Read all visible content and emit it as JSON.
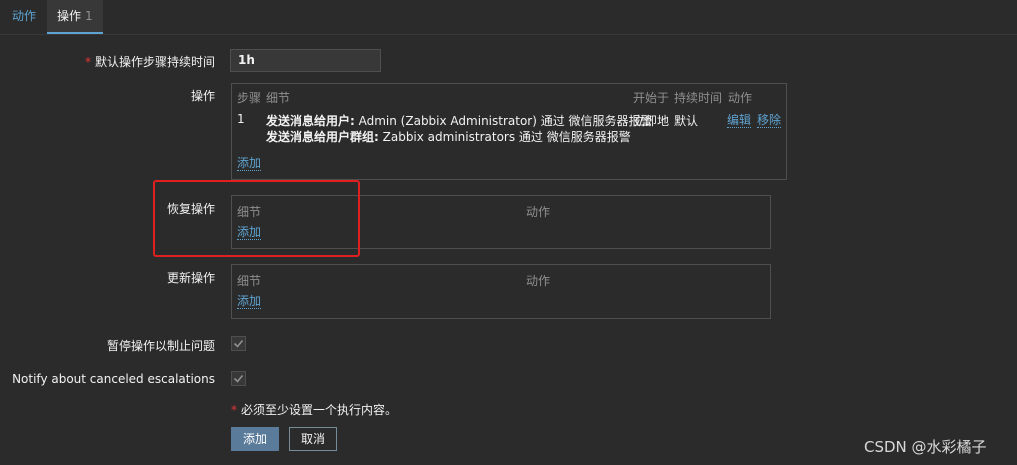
{
  "tabs": [
    {
      "label": "动作",
      "count": ""
    },
    {
      "label": "操作",
      "count": "1"
    }
  ],
  "form": {
    "default_duration": {
      "required": "*",
      "label": "默认操作步骤持续时间",
      "value": "1h"
    },
    "operations": {
      "label": "操作",
      "headers": {
        "step": "步骤",
        "details": "细节",
        "start": "开始于",
        "duration": "持续时间",
        "action": "动作"
      },
      "rows": [
        {
          "step": "1",
          "line1_bold": "发送消息给用户:",
          "line1_rest": " Admin (Zabbix Administrator) 通过 微信服务器报警",
          "line2_bold": "发送消息给用户群组:",
          "line2_rest": " Zabbix administrators 通过 微信服务器报警",
          "start": "立即地",
          "duration": "默认",
          "edit": "编辑",
          "remove": "移除"
        }
      ],
      "add": "添加"
    },
    "recovery": {
      "label": "恢复操作",
      "headers": {
        "details": "细节",
        "action": "动作"
      },
      "add": "添加"
    },
    "update": {
      "label": "更新操作",
      "headers": {
        "details": "细节",
        "action": "动作"
      },
      "add": "添加"
    },
    "pause": {
      "label": "暂停操作以制止问题",
      "checked": true
    },
    "notify": {
      "label": "Notify about canceled escalations",
      "checked": true
    },
    "note": {
      "star": "*",
      "text": "必须至少设置一个执行内容。"
    },
    "buttons": {
      "add": "添加",
      "cancel": "取消"
    }
  },
  "watermark": "CSDN @水彩橘子",
  "colors": {
    "accent": "#5ea3d1",
    "required": "#e33734",
    "highlight": "#e02020",
    "bg": "#2b2b2b"
  }
}
